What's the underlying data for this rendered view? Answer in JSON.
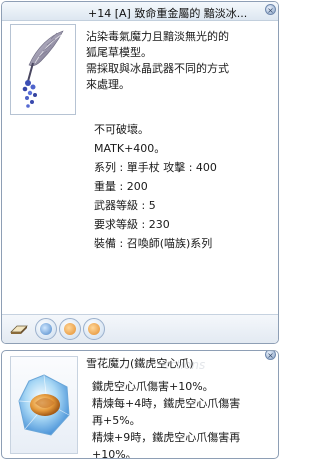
{
  "item_window": {
    "title": "+14 [A] 致命重金屬的 黯淡冰...",
    "description": [
      "沾染毒氣魔力且黯淡無光的的",
      "狐尾草模型。",
      "需採取與冰晶武器不同的方式",
      "來處理。"
    ],
    "stats": [
      "不可破壞。",
      "MATK+400。",
      "系列 : 單手杖 攻擊 : 400",
      "重量 : 200",
      "武器等級 : 5",
      "要求等級 : 230",
      "裝備 : 召喚師(喵族)系列"
    ],
    "slot_icons": [
      "book-icon",
      "card-slot-icon",
      "card-slot-icon",
      "card-slot-icon"
    ],
    "close_label": "×"
  },
  "card_window": {
    "title": "雪花魔力(鐵虎空心爪)",
    "watermark": "ections",
    "lines": [
      "鐵虎空心爪傷害+10%。",
      "精煉每+4時，鐵虎空心爪傷害",
      "再+5%。",
      "精煉+9時，鐵虎空心爪傷害再",
      "+10%。"
    ],
    "close_label": "×"
  }
}
